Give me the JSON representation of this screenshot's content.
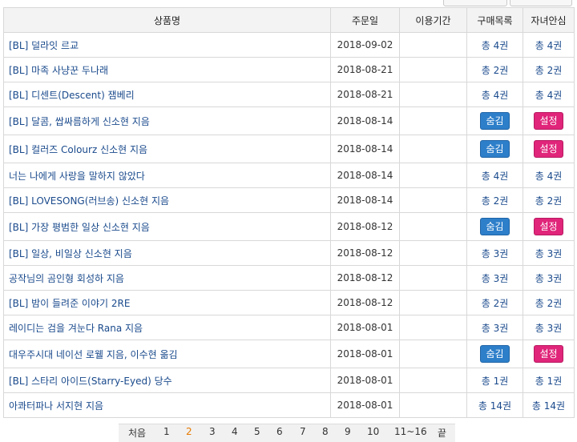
{
  "headers": {
    "title": "상품명",
    "date": "주문일",
    "period": "이용기간",
    "purchase": "구매목록",
    "child": "자녀안심"
  },
  "rows": [
    {
      "title": "[BL] 덜라잇 르교",
      "date": "2018-09-02",
      "purchase": "총 4권",
      "child": "총 4권",
      "type": "text"
    },
    {
      "title": "[BL] 마족 사냥꾼 두나래",
      "date": "2018-08-21",
      "purchase": "총 2권",
      "child": "총 2권",
      "type": "text"
    },
    {
      "title": "[BL] 디센트(Descent) 잼베리",
      "date": "2018-08-21",
      "purchase": "총 4권",
      "child": "총 4권",
      "type": "text"
    },
    {
      "title": "[BL] 달콤, 쌉싸름하게 신소현 지음",
      "date": "2018-08-14",
      "purchase": "숨김",
      "child": "설정",
      "type": "button"
    },
    {
      "title": "[BL] 컬러즈 Colourz 신소현 지음",
      "date": "2018-08-14",
      "purchase": "숨김",
      "child": "설정",
      "type": "button"
    },
    {
      "title": "너는 나에게 사랑을 말하지 않았다",
      "date": "2018-08-14",
      "purchase": "총 4권",
      "child": "총 4권",
      "type": "text"
    },
    {
      "title": "[BL] LOVESONG(러브송) 신소현 지음",
      "date": "2018-08-14",
      "purchase": "총 2권",
      "child": "총 2권",
      "type": "text"
    },
    {
      "title": "[BL] 가장 평범한 일상 신소현 지음",
      "date": "2018-08-12",
      "purchase": "숨김",
      "child": "설정",
      "type": "button"
    },
    {
      "title": "[BL] 일상, 비일상 신소현 지음",
      "date": "2018-08-12",
      "purchase": "총 3권",
      "child": "총 3권",
      "type": "text"
    },
    {
      "title": "공작님의 곰인형 회성하 지음",
      "date": "2018-08-12",
      "purchase": "총 3권",
      "child": "총 3권",
      "type": "text"
    },
    {
      "title": "[BL] 밤이 들려준 이야기 2RE",
      "date": "2018-08-12",
      "purchase": "총 2권",
      "child": "총 2권",
      "type": "text"
    },
    {
      "title": "레이디는 검을 겨눈다 Rana 지음",
      "date": "2018-08-01",
      "purchase": "총 3권",
      "child": "총 3권",
      "type": "text"
    },
    {
      "title": "대우주시대 네이선 로웰 지음, 이수현 옮김",
      "date": "2018-08-01",
      "purchase": "숨김",
      "child": "설정",
      "type": "button"
    },
    {
      "title": "[BL] 스타리 아이드(Starry-Eyed) 당수",
      "date": "2018-08-01",
      "purchase": "총 1권",
      "child": "총 1권",
      "type": "text"
    },
    {
      "title": "아콰터파나 서지현 지음",
      "date": "2018-08-01",
      "purchase": "총 14권",
      "child": "총 14권",
      "type": "text"
    }
  ],
  "pager": {
    "first": "처음",
    "pages": [
      "1",
      "2",
      "3",
      "4",
      "5",
      "6",
      "7",
      "8",
      "9",
      "10"
    ],
    "active": "2",
    "range": "11~16",
    "last": "끝"
  },
  "colors": {
    "hide_button": "#2e7fca",
    "setting_button": "#e0257a",
    "link": "#1a4a8c",
    "active_page": "#e87a00"
  }
}
